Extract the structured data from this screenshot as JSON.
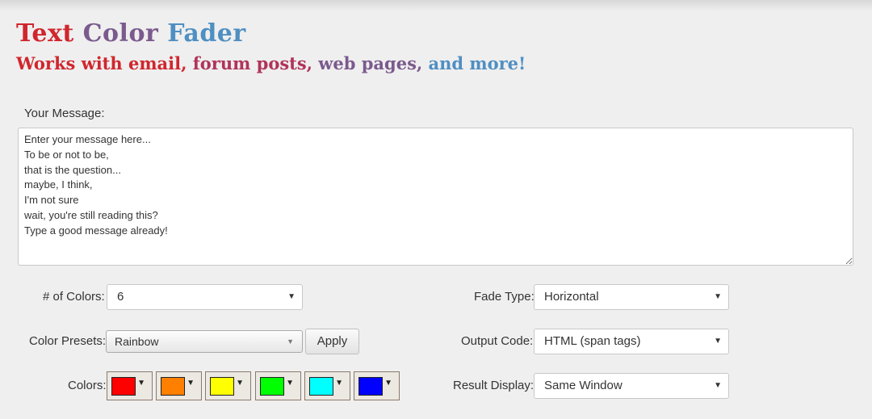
{
  "header": {
    "title_words": [
      "Text",
      "Color",
      "Fader"
    ],
    "title_colors": [
      "#d0262e",
      "#7b5a8e",
      "#4f8fc2"
    ],
    "subtitle_segments": [
      {
        "text": "Works with email, ",
        "color": "#d0262e"
      },
      {
        "text": "forum posts, ",
        "color": "#b0345a"
      },
      {
        "text": "web pages, ",
        "color": "#7b5a8e"
      },
      {
        "text": "and more!",
        "color": "#4f8fc2"
      }
    ]
  },
  "message": {
    "label": "Your Message:",
    "value": "Enter your message here...\nTo be or not to be,\nthat is the question...\nmaybe, I think,\nI'm not sure\nwait, you're still reading this?\nType a good message already!"
  },
  "settings": {
    "num_colors_label": "# of Colors:",
    "num_colors_value": "6",
    "presets_label": "Color Presets:",
    "presets_value": "Rainbow",
    "apply_label": "Apply",
    "colors_label": "Colors:",
    "colors": [
      "#ff0000",
      "#ff7f00",
      "#ffff00",
      "#00ff00",
      "#00ffff",
      "#0000ff"
    ],
    "fade_type_label": "Fade Type:",
    "fade_type_value": "Horizontal",
    "output_code_label": "Output Code:",
    "output_code_value": "HTML (span tags)",
    "result_display_label": "Result Display:",
    "result_display_value": "Same Window"
  }
}
